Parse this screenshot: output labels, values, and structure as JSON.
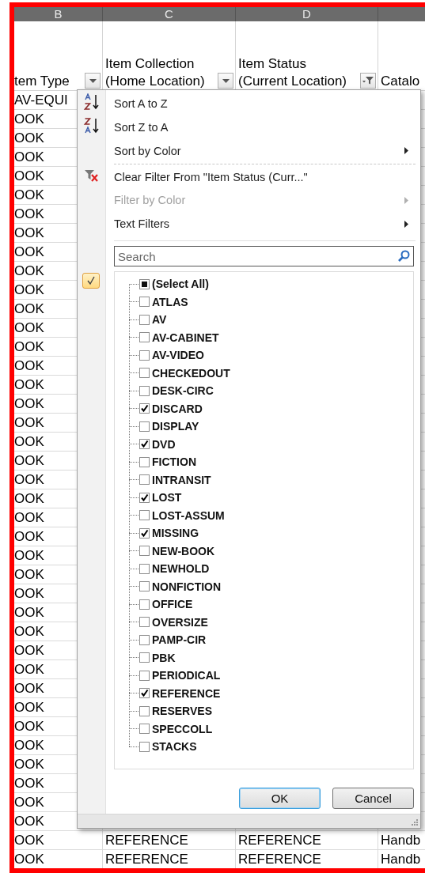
{
  "sheet": {
    "column_letters": [
      "B",
      "C",
      "D"
    ],
    "headers": [
      {
        "label": "tem Type",
        "filtered": false
      },
      {
        "label": "Item Collection (Home Location)",
        "filtered": false
      },
      {
        "label": "Item Status (Current Location)",
        "filtered": true
      },
      {
        "label": "Catalo"
      }
    ],
    "rows": [
      {
        "item_type": "AV-EQUI"
      },
      {
        "item_type": "OOK"
      },
      {
        "item_type": "OOK"
      },
      {
        "item_type": "OOK"
      },
      {
        "item_type": "OOK"
      },
      {
        "item_type": "OOK"
      },
      {
        "item_type": "OOK"
      },
      {
        "item_type": "OOK"
      },
      {
        "item_type": "OOK"
      },
      {
        "item_type": "OOK"
      },
      {
        "item_type": "OOK"
      },
      {
        "item_type": "OOK"
      },
      {
        "item_type": "OOK"
      },
      {
        "item_type": "OOK"
      },
      {
        "item_type": "OOK"
      },
      {
        "item_type": "OOK"
      },
      {
        "item_type": "OOK"
      },
      {
        "item_type": "OOK"
      },
      {
        "item_type": "OOK"
      },
      {
        "item_type": "OOK"
      },
      {
        "item_type": "OOK"
      },
      {
        "item_type": "OOK"
      },
      {
        "item_type": "OOK"
      },
      {
        "item_type": "OOK"
      },
      {
        "item_type": "OOK"
      },
      {
        "item_type": "OOK"
      },
      {
        "item_type": "OOK"
      },
      {
        "item_type": "OOK"
      },
      {
        "item_type": "OOK"
      },
      {
        "item_type": "OOK"
      },
      {
        "item_type": "OOK"
      },
      {
        "item_type": "OOK"
      },
      {
        "item_type": "OOK"
      },
      {
        "item_type": "OOK"
      },
      {
        "item_type": "OOK"
      },
      {
        "item_type": "OOK"
      },
      {
        "item_type": "OOK"
      },
      {
        "item_type": "OOK"
      },
      {
        "item_type": "OOK"
      },
      {
        "item_type": "OOK",
        "collection": "REFERENCE",
        "status": "REFERENCE",
        "catalog": "Handb"
      },
      {
        "item_type": "OOK",
        "collection": "REFERENCE",
        "status": "REFERENCE",
        "catalog": "Handb"
      }
    ]
  },
  "filter_menu": {
    "items": [
      {
        "kind": "sort-ascending",
        "label": "Sort A to Z",
        "disabled": false
      },
      {
        "kind": "sort-descending",
        "label": "Sort Z to A",
        "disabled": false
      },
      {
        "kind": "submenu",
        "label": "Sort by Color",
        "disabled": false
      },
      {
        "kind": "separator"
      },
      {
        "kind": "clear-filter",
        "label": "Clear Filter From \"Item Status (Curr...\"",
        "disabled": false
      },
      {
        "kind": "submenu",
        "label": "Filter by Color",
        "disabled": true
      },
      {
        "kind": "submenu",
        "label": "Text Filters",
        "disabled": false
      }
    ],
    "search": {
      "placeholder": "Search"
    },
    "select_all": {
      "label": "(Select All)",
      "indeterminate": true
    },
    "values": [
      {
        "label": "ATLAS",
        "checked": false
      },
      {
        "label": "AV",
        "checked": false
      },
      {
        "label": "AV-CABINET",
        "checked": false
      },
      {
        "label": "AV-VIDEO",
        "checked": false
      },
      {
        "label": "CHECKEDOUT",
        "checked": false
      },
      {
        "label": "DESK-CIRC",
        "checked": false
      },
      {
        "label": "DISCARD",
        "checked": true
      },
      {
        "label": "DISPLAY",
        "checked": false
      },
      {
        "label": "DVD",
        "checked": true
      },
      {
        "label": "FICTION",
        "checked": false
      },
      {
        "label": "INTRANSIT",
        "checked": false
      },
      {
        "label": "LOST",
        "checked": true
      },
      {
        "label": "LOST-ASSUM",
        "checked": false
      },
      {
        "label": "MISSING",
        "checked": true
      },
      {
        "label": "NEW-BOOK",
        "checked": false
      },
      {
        "label": "NEWHOLD",
        "checked": false
      },
      {
        "label": "NONFICTION",
        "checked": false
      },
      {
        "label": "OFFICE",
        "checked": false
      },
      {
        "label": "OVERSIZE",
        "checked": false
      },
      {
        "label": "PAMP-CIR",
        "checked": false
      },
      {
        "label": "PBK",
        "checked": false
      },
      {
        "label": "PERIODICAL",
        "checked": false
      },
      {
        "label": "REFERENCE",
        "checked": true
      },
      {
        "label": "RESERVES",
        "checked": false
      },
      {
        "label": "SPECCOLL",
        "checked": false
      },
      {
        "label": "STACKS",
        "checked": false
      }
    ],
    "buttons": [
      {
        "label": "OK",
        "focused": true
      },
      {
        "label": "Cancel",
        "focused": false
      }
    ]
  }
}
